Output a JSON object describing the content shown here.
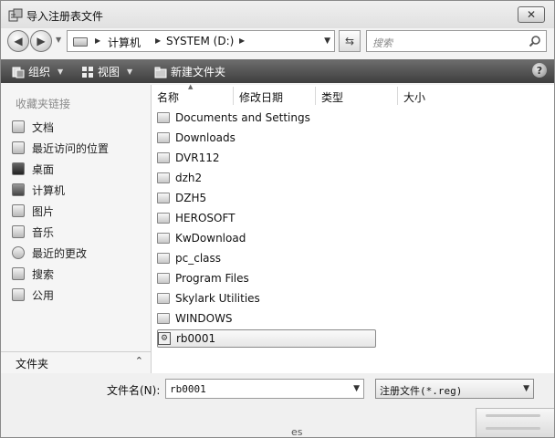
{
  "window": {
    "title": "导入注册表文件",
    "close_glyph": "✕"
  },
  "address_bar": {
    "segments": [
      "计算机",
      "SYSTEM (D:)"
    ],
    "search_placeholder": "搜索"
  },
  "toolbar": {
    "organize_label": "组织",
    "views_label": "视图",
    "new_folder_label": "新建文件夹",
    "help_glyph": "?"
  },
  "sidebar": {
    "header": "收藏夹链接",
    "items": [
      {
        "label": "文档",
        "icon": "document-icon"
      },
      {
        "label": "最近访问的位置",
        "icon": "recent-places-icon"
      },
      {
        "label": "桌面",
        "icon": "desktop-icon"
      },
      {
        "label": "计算机",
        "icon": "computer-icon"
      },
      {
        "label": "图片",
        "icon": "pictures-icon"
      },
      {
        "label": "音乐",
        "icon": "music-icon"
      },
      {
        "label": "最近的更改",
        "icon": "recent-changes-icon"
      },
      {
        "label": "搜索",
        "icon": "search-folder-icon"
      },
      {
        "label": "公用",
        "icon": "public-icon"
      }
    ],
    "folders_label": "文件夹",
    "folders_chevron": "⌃"
  },
  "file_list": {
    "columns": [
      "名称",
      "修改日期",
      "类型",
      "大小"
    ],
    "items": [
      "Documents and Settings",
      "Downloads",
      "DVR112",
      "dzh2",
      "DZH5",
      "HEROSOFT",
      "KwDownload",
      "pc_class",
      "Program Files",
      "Skylark Utilities",
      "WINDOWS"
    ],
    "selected_file": "rb0001"
  },
  "bottom": {
    "filename_label": "文件名(N):",
    "filename_value": "rb0001",
    "filetype_value": "注册文件(*.reg)",
    "fragment_text": "es"
  }
}
